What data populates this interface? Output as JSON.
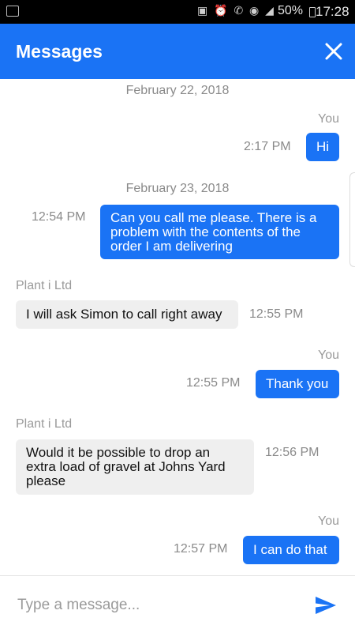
{
  "status_bar": {
    "battery": "50%",
    "time": "17:28"
  },
  "header": {
    "title": "Messages",
    "close_icon": "close-icon"
  },
  "conversation": {
    "date1": "February 22, 2018",
    "you1": "You",
    "time1": "2:17 PM",
    "msg1": "Hi",
    "date2": "February 23, 2018",
    "time2": "12:54 PM",
    "msg2": "Can you call me please. There is a\nproblem with the contents of the\norder I am delivering",
    "sender3": "Plant i Ltd",
    "msg3": "I will ask Simon to call right away",
    "time3": "12:55 PM",
    "you4": "You",
    "time4": "12:55 PM",
    "msg4": "Thank you",
    "sender5": "Plant i Ltd",
    "msg5": "Would it be possible to drop an\nextra load of gravel at Johns Yard\nplease",
    "time5": "12:56 PM",
    "you6": "You",
    "time6": "12:57 PM",
    "msg6": "I can do that"
  },
  "composer": {
    "placeholder": "Type a message...",
    "send_icon": "send-icon"
  },
  "colors": {
    "accent": "#1a73f5",
    "incoming_bubble": "#efefef"
  }
}
